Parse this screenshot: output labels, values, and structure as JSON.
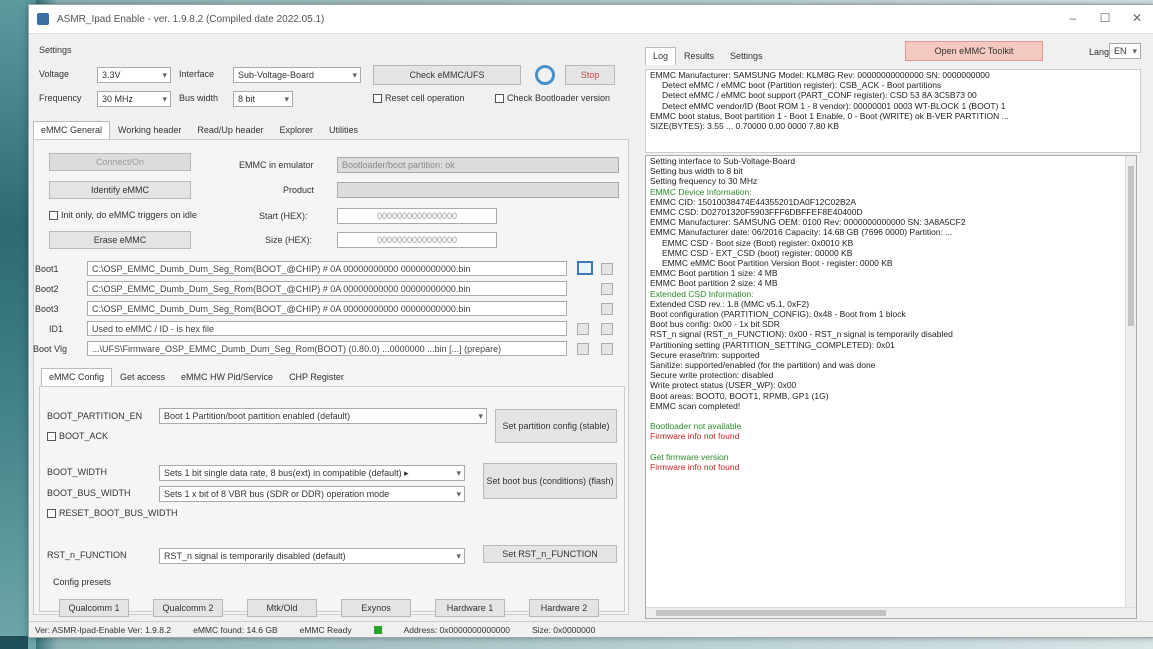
{
  "window": {
    "title": "ASMR_Ipad Enable - ver. 1.9.8.2 (Compiled date 2022.05.1)",
    "minimize": "–",
    "maximize": "☐",
    "close": "✕"
  },
  "settings": {
    "section_label": "Settings",
    "voltage_label": "Voltage",
    "voltage_value": "3.3V",
    "interface_label": "Interface",
    "interface_value": "Sub-Voltage-Board",
    "frequency_label": "Frequency",
    "frequency_value": "30 MHz",
    "bus_width_label": "Bus width",
    "bus_width_value": "8 bit",
    "check_emmc_button": "Check eMMC/UFS",
    "stop_button": "Stop",
    "reset_on_connect": "Reset cell operation",
    "check_bootloader": "Check Bootloader version"
  },
  "main_tabs": [
    "eMMC General",
    "Working header",
    "Read/Up header",
    "Explorer",
    "Utilities"
  ],
  "main_tabs_active": 0,
  "emmc_general": {
    "connect_button": "Connect/On",
    "identify_button": "Identify eMMC",
    "init_checkbox": "Init only, do eMMC triggers on idle",
    "erase_button": "Erase eMMC",
    "emmc_in_emulator_label": "EMMC in emulator",
    "emmc_in_emulator_value": "Bootloader/boot partition: ok",
    "product_label": "Product",
    "start_addr_label": "Start (HEX):",
    "start_addr_value": "0000000000000000",
    "size_label": "Size (HEX):",
    "size_value": "0000000000000000"
  },
  "file_rows": [
    {
      "label": "Boot1",
      "value": "C:\\OSP_EMMC_Dumb_Dum_Seg_Rom(BOOT_@CHIP) # 0A  00000000000  00000000000.bin"
    },
    {
      "label": "Boot2",
      "value": "C:\\OSP_EMMC_Dumb_Dum_Seg_Rom(BOOT_@CHIP) # 0A  00000000000  00000000000.bin"
    },
    {
      "label": "Boot3",
      "value": "C:\\OSP_EMMC_Dumb_Dum_Seg_Rom(BOOT_@CHIP) # 0A  00000000000  00000000000.bin"
    },
    {
      "label": "ID1",
      "value": "Used to eMMC / ID - is hex file"
    },
    {
      "label": "Boot Vlg",
      "value": "...\\UFS\\Firmware_OSP_EMMC_Dumb_Dum_Seg_Rom(BOOT) (0.80.0) ...0000000 ...bin [...] (prepare)"
    }
  ],
  "sub_tabs": [
    "eMMC Config",
    "Get access",
    "eMMC HW Pid/Service",
    "CHP Register"
  ],
  "sub_tabs_active": 0,
  "ext_csd": {
    "boot_partition_label": "BOOT_PARTITION_EN",
    "boot_partition_value": "Boot 1 Partition/boot partition enabled (default)",
    "boot_ack_checkbox": "BOOT_ACK",
    "set_partition_button": "Set partition config (stable)",
    "bus_width_label": "BOOT_WIDTH",
    "bus_width_value": "Sets 1 bit single data rate, 8 bus(ext) in compatible (default) ▸",
    "bus_mode_label": "BOOT_BUS_WIDTH",
    "bus_mode_value": "Sets 1 x bit of 8 VBR bus (SDR or DDR) operation mode",
    "reset_checkbox": "RESET_BOOT_BUS_WIDTH",
    "set_boot_bus_button": "Set boot bus (conditions) (flash)",
    "rst_n_label": "RST_n_FUNCTION",
    "rst_n_value": "RST_n signal is temporarily disabled (default)",
    "set_rst_button": "Set RST_n_FUNCTION"
  },
  "config_presets": {
    "label": "Config presets",
    "buttons": [
      "Qualcomm 1",
      "Qualcomm 2",
      "Mtk/Old",
      "Exynos",
      "Hardware 1",
      "Hardware 2"
    ]
  },
  "right": {
    "tabs": [
      "Log",
      "Results",
      "Settings"
    ],
    "tabs_active": 0,
    "open_emmc_toolkit_button": "Open eMMC Toolkit",
    "lang_label": "Lang",
    "lang_value": "EN",
    "top_lines": [
      "EMMC Manufacturer:  SAMSUNG  Model: KLM8G  Rev: 00000000000000  SN: 0000000000",
      "  Detect eMMC / eMMC boot (Partition register):  CSB_ACK - Boot partitions",
      "  Detect eMMC / eMMC boot support (PART_CONF register):  CSD 53  8A 3C5B73  00",
      "  Detect eMMC vendor/ID (Boot ROM 1 - 8 vendor):  00000001  0003 WT-BLOCK  1 (BOOT) 1",
      "EMMC boot status, Boot partition 1 - Boot 1 Enable, 0 - Boot (WRITE) ok   B-VER   PARTITION  ...",
      "  SIZE(BYTES): 3.55  ... 0.70000 0.00  0000 7.80 KB"
    ],
    "log_lines": [
      {
        "t": "Setting interface to Sub-Voltage-Board",
        "c": ""
      },
      {
        "t": "Setting bus width to 8 bit",
        "c": ""
      },
      {
        "t": "Setting frequency to 30 MHz",
        "c": ""
      },
      {
        "t": "EMMC Device Information:",
        "c": "green"
      },
      {
        "t": "EMMC CID: 15010038474E44355201DA0F12C02B2A",
        "c": ""
      },
      {
        "t": "EMMC CSD: D02701320F5903FFF6DBFFEF8E40400D",
        "c": ""
      },
      {
        "t": "EMMC Manufacturer: SAMSUNG   OEM: 0100   Rev: 0000000000000   SN: 3A8A5CF2",
        "c": ""
      },
      {
        "t": "EMMC Manufacturer date:  06/2016   Capacity:  14.68 GB (7696 0000)  Partition:  ...",
        "c": ""
      },
      {
        "t": "  EMMC CSD - Boot size (Boot) register:  0x0010 KB",
        "c": "ind"
      },
      {
        "t": "  EMMC CSD - EXT_CSD (boot) register:  00000 KB",
        "c": "ind"
      },
      {
        "t": "  EMMC eMMC Boot Partition Version Boot - register:  0000 KB",
        "c": "ind"
      },
      {
        "t": "EMMC Boot partition 1 size:  4 MB",
        "c": ""
      },
      {
        "t": "EMMC Boot partition 2 size:  4 MB",
        "c": ""
      },
      {
        "t": "Extended CSD Information:",
        "c": "green"
      },
      {
        "t": "Extended CSD rev.: 1.8 (MMC v5.1, 0xF2)",
        "c": ""
      },
      {
        "t": "Boot configuration (PARTITION_CONFIG): 0x48 - Boot from 1 block",
        "c": ""
      },
      {
        "t": "Boot bus config: 0x00 - 1x bit SDR",
        "c": ""
      },
      {
        "t": "RST_n signal (RST_n_FUNCTION): 0x00 - RST_n signal is temporarily disabled",
        "c": ""
      },
      {
        "t": "Partitioning setting (PARTITION_SETTING_COMPLETED): 0x01",
        "c": ""
      },
      {
        "t": "Secure erase/trim: supported",
        "c": ""
      },
      {
        "t": "Sanitize: supported/enabled (for the partition) and was done",
        "c": ""
      },
      {
        "t": "Secure write protection: disabled",
        "c": ""
      },
      {
        "t": "Write protect status (USER_WP): 0x00",
        "c": ""
      },
      {
        "t": "Boot areas:  BOOT0, BOOT1, RPMB, GP1 (1G)",
        "c": ""
      },
      {
        "t": "EMMC scan completed!",
        "c": ""
      },
      {
        "t": "",
        "c": ""
      },
      {
        "t": "Bootloader not available",
        "c": "green"
      },
      {
        "t": "Firmware info not found",
        "c": "red"
      },
      {
        "t": "",
        "c": ""
      },
      {
        "t": "Get firmware version",
        "c": "green"
      },
      {
        "t": "Firmware info not found",
        "c": "red"
      }
    ]
  },
  "statusbar": {
    "left": "Ver: ASMR-Ipad-Enable Ver: 1.9.8.2",
    "mid1": "eMMC found: 14.6 GB",
    "mid2": "eMMC Ready",
    "mid3": "Address: 0x0000000000000",
    "right": "Size: 0x0000000"
  }
}
